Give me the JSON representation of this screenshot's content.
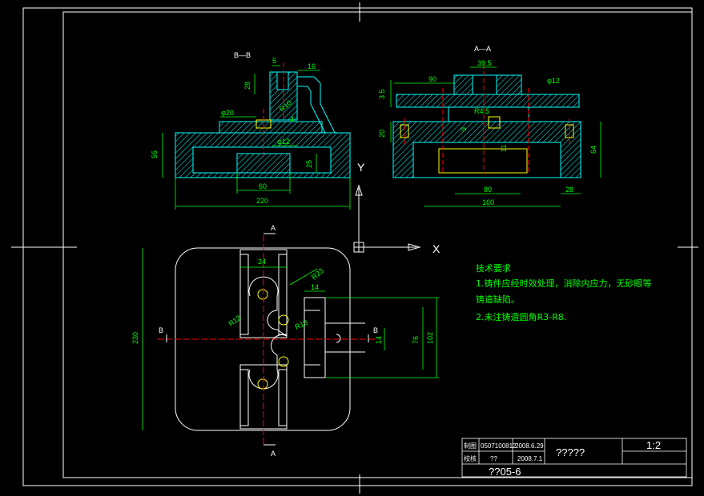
{
  "views": {
    "section_b": "B—B",
    "section_a": "A—A",
    "axis_y": "Y",
    "axis_x": "X",
    "cut_a": "A",
    "cut_b": "B"
  },
  "dims_left": {
    "d5": "5",
    "d16": "16",
    "d28": "28",
    "phi20": "φ20",
    "r10": "R10",
    "d4": "4",
    "phi12": "φ12",
    "d55": "55",
    "d25": "25",
    "d60": "60",
    "d220": "220"
  },
  "dims_right": {
    "d39_5": "39.5",
    "d90": "90",
    "phi12": "φ12",
    "d3_5": "3.5",
    "r4_5": "R4.5",
    "d20": "20",
    "d9": "9",
    "d11": "11",
    "d64": "64",
    "d80": "80",
    "d28": "28",
    "d160": "160"
  },
  "dims_plan": {
    "d24": "24",
    "r23": "R23",
    "d14a": "14",
    "r12": "R12",
    "r13": "R13",
    "d230": "230",
    "d14b": "14",
    "d76": "76",
    "d102": "102"
  },
  "notes": {
    "heading": "技术要求",
    "line1": "1.铸件应经时效处理，消除内应力，无砂眼等",
    "line1b": "铸造缺陷。",
    "line2": "2.未注铸造圆角R3-R8."
  },
  "title_block": {
    "row1_label": "制图",
    "row1_name": "0507100812",
    "row1_date": "2008.6.29",
    "row2_label": "校核",
    "row2_name": "??",
    "row2_date": "2008.7.1",
    "title": "?????",
    "scale": "1:2",
    "drawing_no": "??05-6"
  }
}
